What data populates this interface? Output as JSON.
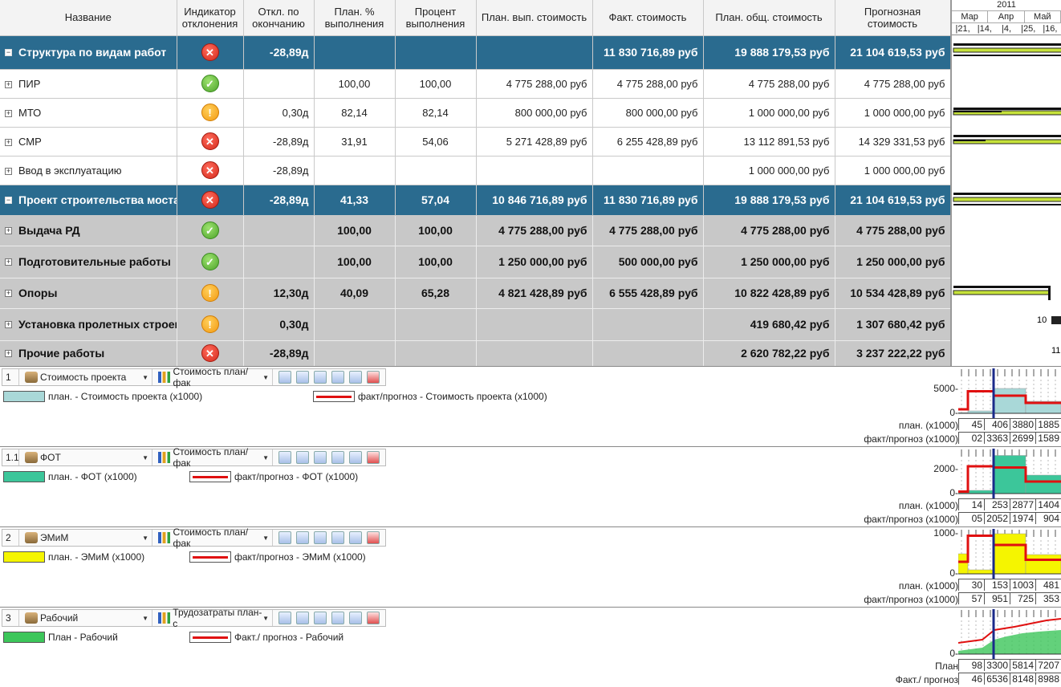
{
  "columns": [
    "Название",
    "Индикатор отклонения",
    "Откл. по окончанию",
    "План. % выполнения",
    "Процент выполнения",
    "План. вып. стоимость",
    "Факт. стоимость",
    "План. общ. стоимость",
    "Прогнозная стоимость"
  ],
  "rows": [
    {
      "style": "blue",
      "exp": "−",
      "name": "Структура по видам работ",
      "ind": "red",
      "dev": "-28,89д",
      "plan_pct": "",
      "pct": "",
      "plan_cost": "",
      "fact_cost": "11 830 716,89 руб",
      "plan_total": "19 888 179,53 руб",
      "forecast": "21 104 619,53 руб"
    },
    {
      "style": "white",
      "exp": "+",
      "name": "ПИР",
      "ind": "green",
      "dev": "",
      "plan_pct": "100,00",
      "pct": "100,00",
      "plan_cost": "4 775 288,00 руб",
      "fact_cost": "4 775 288,00 руб",
      "plan_total": "4 775 288,00 руб",
      "forecast": "4 775 288,00 руб"
    },
    {
      "style": "white",
      "exp": "+",
      "name": "МТО",
      "ind": "orange",
      "dev": "0,30д",
      "plan_pct": "82,14",
      "pct": "82,14",
      "plan_cost": "800 000,00 руб",
      "fact_cost": "800 000,00 руб",
      "plan_total": "1 000 000,00 руб",
      "forecast": "1 000 000,00 руб"
    },
    {
      "style": "white",
      "exp": "+",
      "name": "СМР",
      "ind": "red",
      "dev": "-28,89д",
      "plan_pct": "31,91",
      "pct": "54,06",
      "plan_cost": "5 271 428,89 руб",
      "fact_cost": "6 255 428,89 руб",
      "plan_total": "13 112 891,53 руб",
      "forecast": "14 329 331,53 руб"
    },
    {
      "style": "white",
      "exp": "+",
      "name": "Ввод в эксплуатацию",
      "ind": "red",
      "dev": "-28,89д",
      "plan_pct": "",
      "pct": "",
      "plan_cost": "",
      "fact_cost": "",
      "plan_total": "1 000 000,00 руб",
      "forecast": "1 000 000,00 руб"
    },
    {
      "style": "blue",
      "exp": "−",
      "name": "Проект строительства моста",
      "ind": "red",
      "dev": "-28,89д",
      "plan_pct": "41,33",
      "pct": "57,04",
      "plan_cost": "10 846 716,89 руб",
      "fact_cost": "11 830 716,89 руб",
      "plan_total": "19 888 179,53 руб",
      "forecast": "21 104 619,53 руб"
    },
    {
      "style": "gray",
      "exp": "+",
      "name": "Выдача РД",
      "ind": "green",
      "dev": "",
      "plan_pct": "100,00",
      "pct": "100,00",
      "plan_cost": "4 775 288,00 руб",
      "fact_cost": "4 775 288,00 руб",
      "plan_total": "4 775 288,00 руб",
      "forecast": "4 775 288,00 руб"
    },
    {
      "style": "gray",
      "exp": "+",
      "name": "Подготовительные работы",
      "ind": "green",
      "dev": "",
      "plan_pct": "100,00",
      "pct": "100,00",
      "plan_cost": "1 250 000,00 руб",
      "fact_cost": "500 000,00 руб",
      "plan_total": "1 250 000,00 руб",
      "forecast": "1 250 000,00 руб"
    },
    {
      "style": "gray",
      "exp": "+",
      "name": "Опоры",
      "ind": "orange",
      "dev": "12,30д",
      "plan_pct": "40,09",
      "pct": "65,28",
      "plan_cost": "4 821 428,89 руб",
      "fact_cost": "6 555 428,89 руб",
      "plan_total": "10 822 428,89 руб",
      "forecast": "10 534 428,89 руб"
    },
    {
      "style": "gray",
      "exp": "+",
      "name": "Установка пролетных строений",
      "ind": "orange",
      "dev": "0,30д",
      "plan_pct": "",
      "pct": "",
      "plan_cost": "",
      "fact_cost": "",
      "plan_total": "419 680,42 руб",
      "forecast": "1 307 680,42 руб"
    },
    {
      "style": "gray",
      "exp": "+",
      "name": "Прочие работы",
      "ind": "red",
      "dev": "-28,89д",
      "plan_pct": "",
      "pct": "",
      "plan_cost": "",
      "fact_cost": "",
      "plan_total": "2 620 782,22 руб",
      "forecast": "3 237 222,22 руб"
    }
  ],
  "gantt": {
    "year": "2011",
    "months": [
      "Мар",
      "Апр",
      "Май"
    ],
    "days": [
      "21",
      "14",
      "4",
      "25",
      "16"
    ],
    "labels": [
      "10",
      "11"
    ]
  },
  "panels": [
    {
      "num": "1",
      "resource": "Стоимость проекта",
      "mode": "Стоимость план/фак",
      "plan_legend": "план. - Стоимость проекта (x1000)",
      "fact_legend": "факт/прогноз - Стоимость проекта (x1000)",
      "plan_color": "#a9d8d8",
      "ticks": [
        "5000-",
        "0-"
      ],
      "plan_label": "план. (x1000)",
      "fact_label": "факт/прогноз (x1000)",
      "plan_vals": [
        "45",
        "406",
        "3880",
        "1885"
      ],
      "fact_vals": [
        "02",
        "3363",
        "2699",
        "1589"
      ]
    },
    {
      "num": "1.1",
      "resource": "ФОТ",
      "mode": "Стоимость план/фак",
      "plan_legend": "план. - ФОТ (x1000)",
      "fact_legend": "факт/прогноз - ФОТ (x1000)",
      "plan_color": "#3cc69a",
      "ticks": [
        "2000-",
        "0-"
      ],
      "plan_label": "план. (x1000)",
      "fact_label": "факт/прогноз (x1000)",
      "plan_vals": [
        "14",
        "253",
        "2877",
        "1404"
      ],
      "fact_vals": [
        "05",
        "2052",
        "1974",
        "904"
      ]
    },
    {
      "num": "2",
      "resource": "ЭМиМ",
      "mode": "Стоимость план/фак",
      "plan_legend": "план. - ЭМиМ (x1000)",
      "fact_legend": "факт/прогноз - ЭМиМ (x1000)",
      "plan_color": "#f5f500",
      "ticks": [
        "1000-",
        "0-"
      ],
      "plan_label": "план. (x1000)",
      "fact_label": "факт/прогноз (x1000)",
      "plan_vals": [
        "30",
        "153",
        "1003",
        "481"
      ],
      "fact_vals": [
        "57",
        "951",
        "725",
        "353"
      ]
    },
    {
      "num": "3",
      "resource": "Рабочий",
      "mode": "Трудозатраты план-с",
      "plan_legend": "План - Рабочий",
      "fact_legend": "Факт./ прогноз - Рабочий",
      "plan_color": "#3cc65a",
      "ticks": [
        "0-"
      ],
      "plan_label": "План",
      "fact_label": "Факт./ прогноз",
      "plan_vals": [
        "98",
        "3300",
        "5814",
        "7207"
      ],
      "fact_vals": [
        "46",
        "6536",
        "8148",
        "8988"
      ]
    }
  ]
}
